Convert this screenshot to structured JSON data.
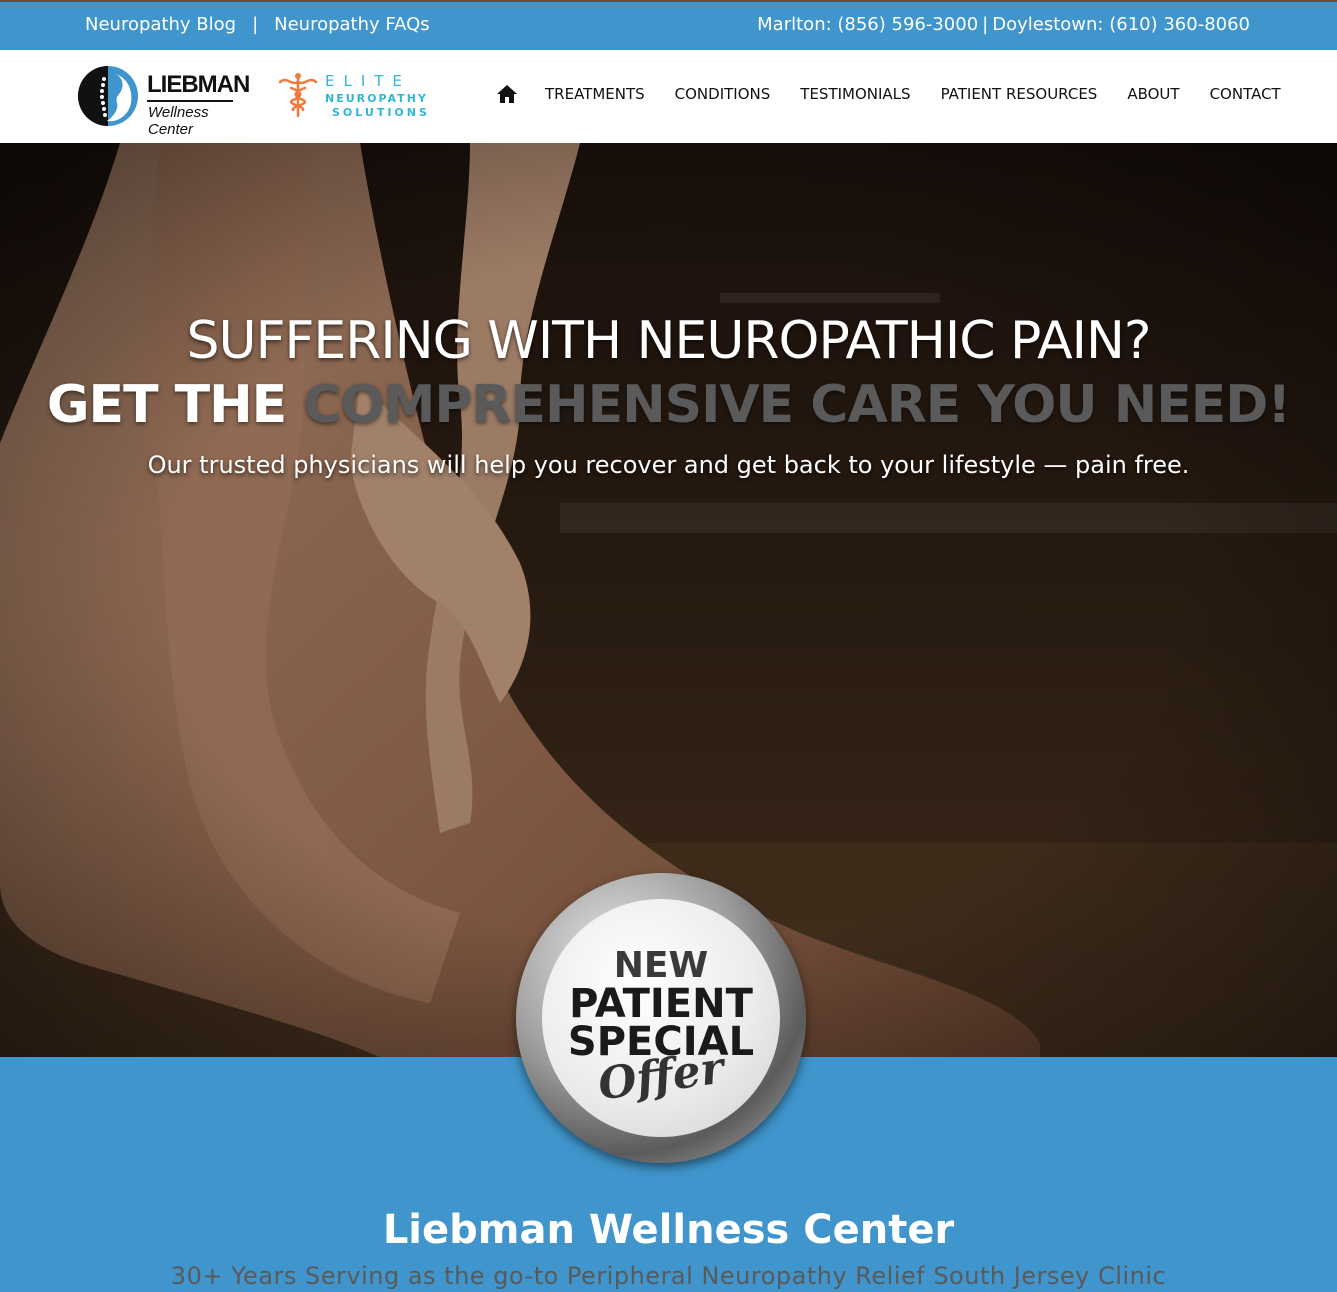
{
  "topbar": {
    "links": [
      "Neuropathy Blog",
      "Neuropathy FAQs"
    ],
    "separator": "|",
    "phones": {
      "marlton": "Marlton: (856) 596-3000",
      "sep": "|",
      "doylestown": "Doylestown: (610) 360-8060"
    }
  },
  "logos": {
    "primary": {
      "name": "LIEBMAN",
      "sub": "Wellness Center"
    },
    "secondary": {
      "line1": "ELITE",
      "line2": "NEUROPATHY",
      "line3": "SOLUTIONS"
    }
  },
  "nav": {
    "home_icon": "home-icon",
    "items": [
      "TREATMENTS",
      "CONDITIONS",
      "TESTIMONIALS",
      "PATIENT RESOURCES",
      "ABOUT",
      "CONTACT"
    ]
  },
  "hero": {
    "headline": "SUFFERING WITH NEUROPATHIC PAIN?",
    "subheadline_part1": "GET THE ",
    "subheadline_part2": "COMPREHENSIVE CARE YOU NEED!",
    "tagline": "Our trusted physicians will help you recover and get back to your lifestyle — pain free."
  },
  "badge": {
    "line1": "NEW",
    "line2": "PATIENT",
    "line3": "SPECIAL",
    "line4": "Offer"
  },
  "band": {
    "title": "Liebman Wellness Center",
    "subtitle": "30+ Years Serving as the go-to Peripheral Neuropathy Relief South Jersey Clinic"
  },
  "colors": {
    "brand_blue": "#3f95cc",
    "accent_cyan": "#2fb8d3",
    "caduceus_orange": "#f07a3c"
  }
}
